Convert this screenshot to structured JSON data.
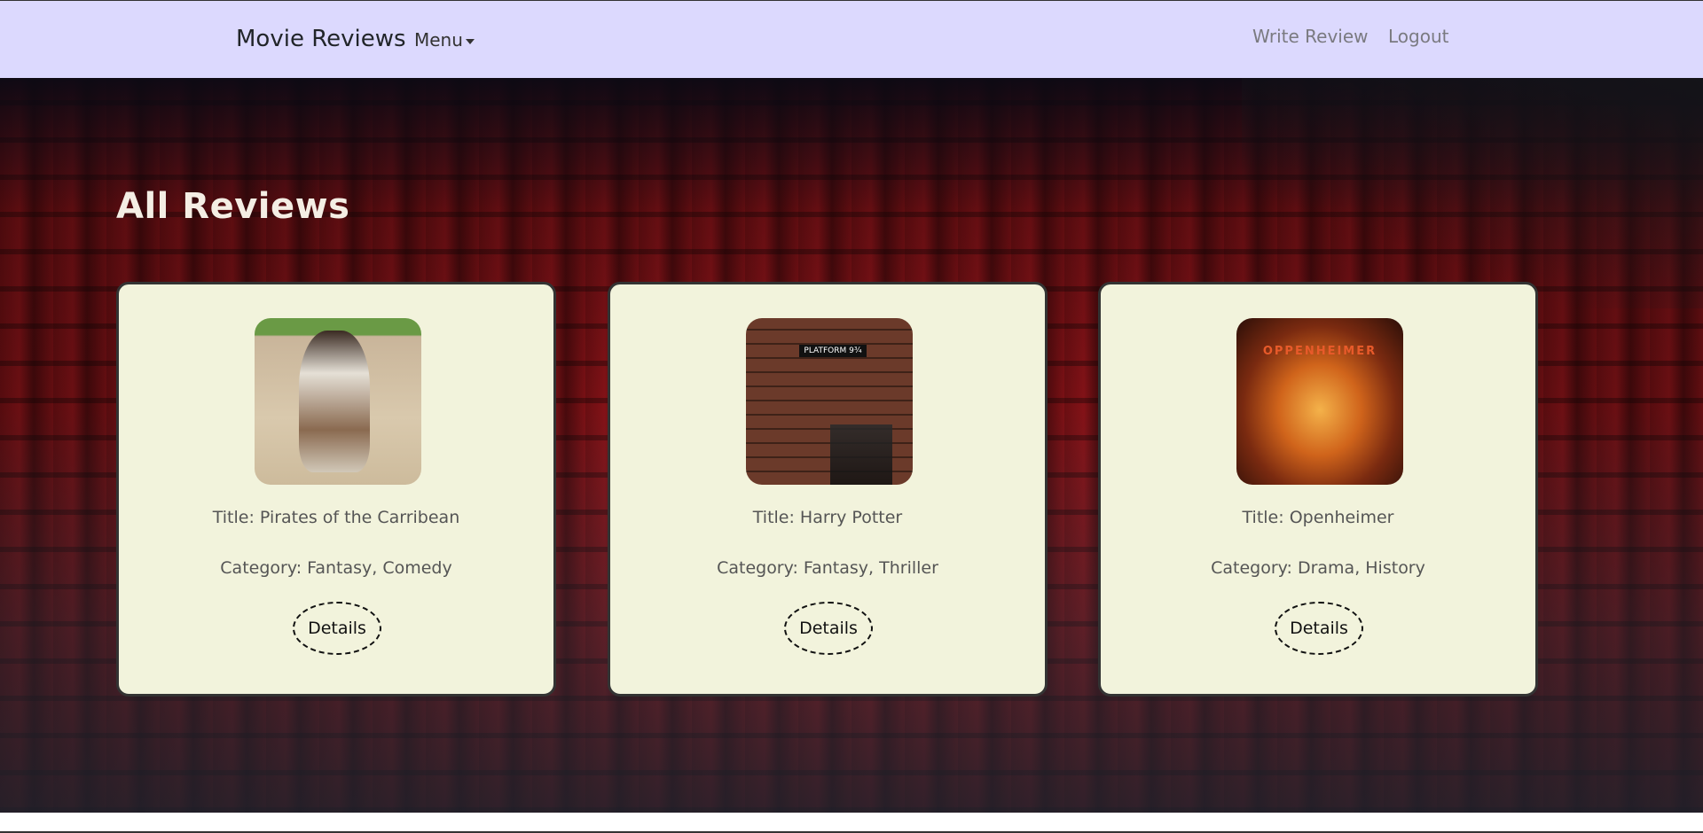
{
  "navbar": {
    "brand": "Movie Reviews",
    "menu_label": "Menu",
    "links": [
      "Write Review",
      "Logout"
    ]
  },
  "page": {
    "heading": "All Reviews"
  },
  "reviews": [
    {
      "title": "Title: Pirates of the Carribean",
      "category": "Category: Fantasy, Comedy",
      "button": "Details"
    },
    {
      "title": "Title: Harry Potter",
      "category": "Category: Fantasy, Thriller",
      "button": "Details"
    },
    {
      "title": "Title: Openheimer",
      "category": "Category: Drama, History",
      "button": "Details"
    }
  ],
  "poster_texts": {
    "platform_sign": "PLATFORM 9¾",
    "oppenheimer_title": "OPPENHEIMER"
  }
}
